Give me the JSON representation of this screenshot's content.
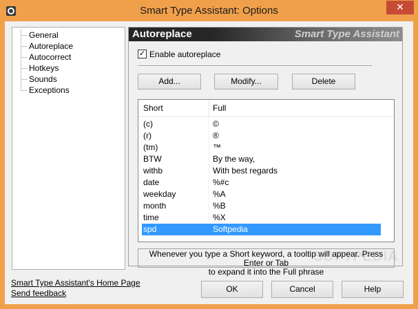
{
  "window": {
    "title": "Smart Type Assistant: Options",
    "close_label": "✕",
    "colors": {
      "frame": "#f0a04b",
      "close": "#c74a35",
      "selection": "#3399ff"
    }
  },
  "tree": {
    "items": [
      {
        "label": "General"
      },
      {
        "label": "Autoreplace"
      },
      {
        "label": "Autocorrect"
      },
      {
        "label": "Hotkeys"
      },
      {
        "label": "Sounds"
      },
      {
        "label": "Exceptions"
      }
    ]
  },
  "panel": {
    "title": "Autoreplace",
    "brand": "Smart Type Assistant",
    "enable_label": "Enable autoreplace",
    "enable_checked": true,
    "buttons": {
      "add": "Add...",
      "modify": "Modify...",
      "delete": "Delete"
    },
    "table": {
      "headers": {
        "short": "Short",
        "full": "Full"
      },
      "rows": [
        {
          "short": "(c)",
          "full": "©"
        },
        {
          "short": "(r)",
          "full": "®"
        },
        {
          "short": "(tm)",
          "full": "™"
        },
        {
          "short": "BTW",
          "full": "By the way,"
        },
        {
          "short": "withb",
          "full": "With best regards"
        },
        {
          "short": "date",
          "full": "%#c"
        },
        {
          "short": "weekday",
          "full": "%A"
        },
        {
          "short": "month",
          "full": "%B"
        },
        {
          "short": "time",
          "full": "%X"
        },
        {
          "short": "spd",
          "full": "Softpedia",
          "selected": true
        }
      ]
    },
    "hint_line1": "Whenever you type a Short keyword, a tooltip will appear. Press Enter or Tab",
    "hint_line2": "to expand it into the Full phrase"
  },
  "footer": {
    "home_link": "Smart Type Assistant's Home Page",
    "feedback_link": "Send feedback",
    "ok": "OK",
    "cancel": "Cancel",
    "help": "Help"
  },
  "watermark": "SOFTPEDIA"
}
